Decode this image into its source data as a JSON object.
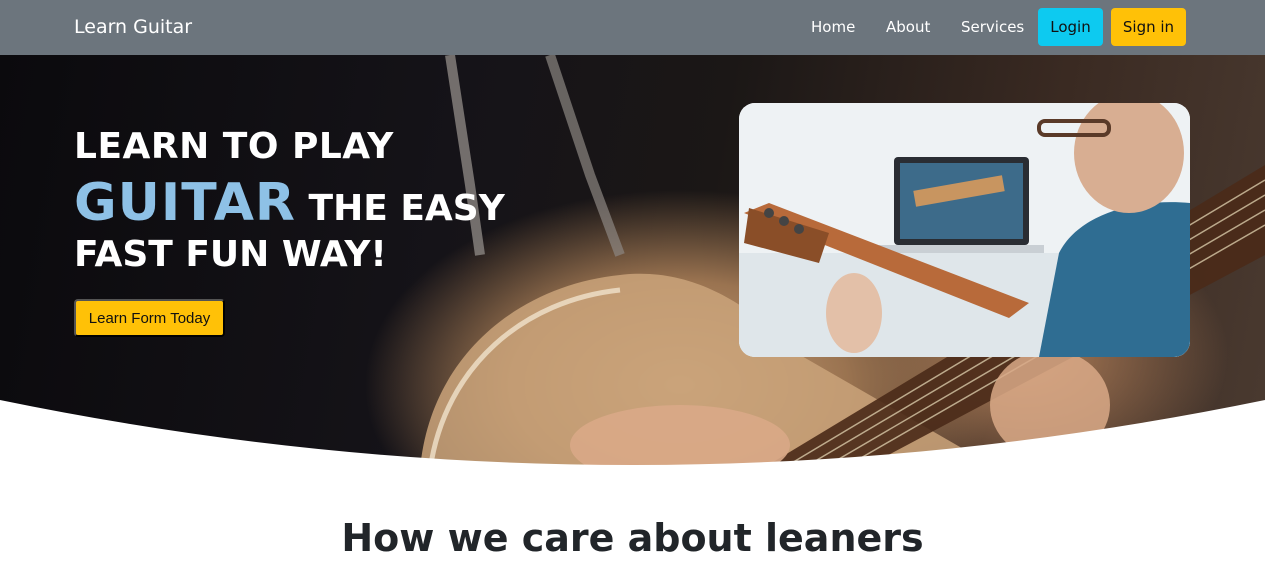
{
  "nav": {
    "brand": "Learn Guitar",
    "links": [
      "Home",
      "About",
      "Services"
    ],
    "login_label": "Login",
    "signin_label": "Sign in"
  },
  "hero": {
    "line1": "LEARN TO PLAY",
    "line2_highlight": "GUITAR",
    "line2_rest": "THE EASY",
    "line3": "FAST FUN WAY!",
    "cta_label": "Learn Form Today"
  },
  "section": {
    "title": "How we care about leaners"
  },
  "colors": {
    "navbar": "#6c757d",
    "login_button": "#0dcaf0",
    "signin_button": "#ffc107",
    "highlight": "#8ec1e6"
  },
  "icons": {
    "hero_background": "guitar-player-photo",
    "side_photo": "man-learning-guitar-laptop-photo"
  }
}
